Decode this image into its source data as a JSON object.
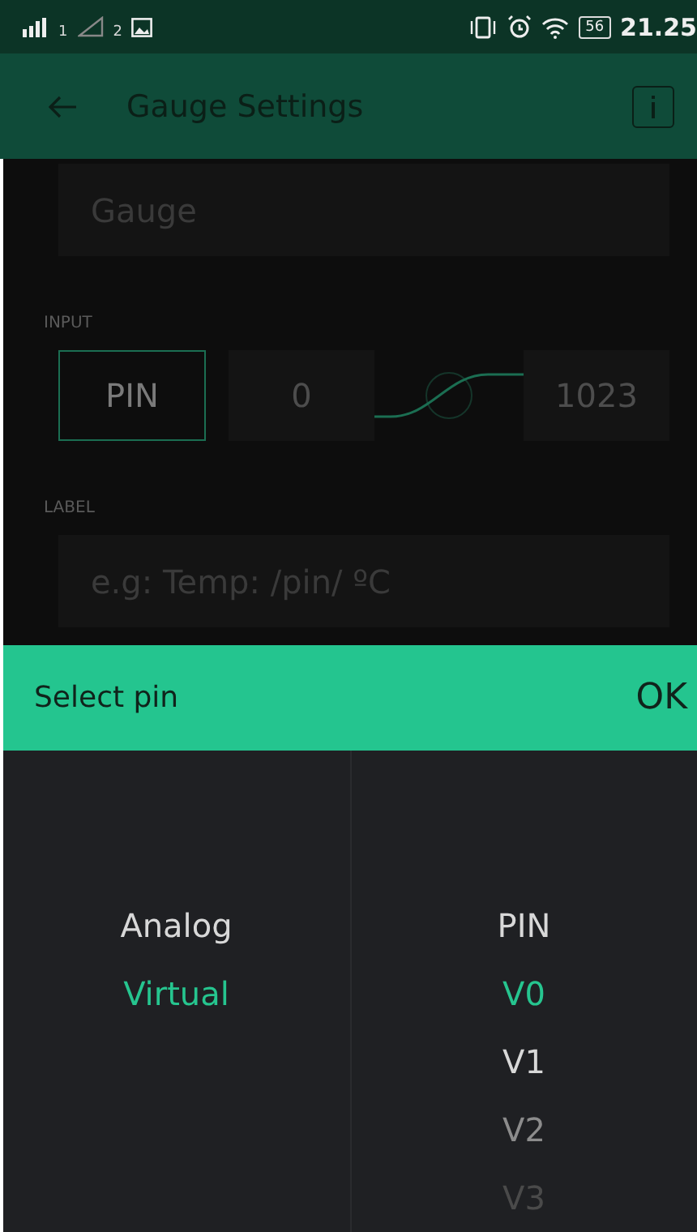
{
  "status_bar": {
    "sim_1": "1",
    "sim_2": "2",
    "battery": "56",
    "time": "21.25"
  },
  "app_bar": {
    "title": "Gauge Settings"
  },
  "form": {
    "name_field": {
      "value": "Gauge"
    },
    "input": {
      "heading": "INPUT",
      "pin_button": {
        "label": "PIN",
        "selected": true
      },
      "min": "0",
      "max": "1023"
    },
    "label": {
      "heading": "LABEL",
      "placeholder": "e.g: Temp: /pin/ ºC"
    }
  },
  "picker": {
    "title": "Select pin",
    "ok": "OK",
    "columns": [
      {
        "items": [
          {
            "label": "Analog",
            "selected": false
          },
          {
            "label": "Virtual",
            "selected": true
          }
        ]
      },
      {
        "items": [
          {
            "label": "PIN",
            "selected": false
          },
          {
            "label": "V0",
            "selected": true
          },
          {
            "label": "V1",
            "selected": false
          },
          {
            "label": "V2",
            "selected": false
          },
          {
            "label": "V3",
            "selected": false
          }
        ]
      }
    ]
  }
}
